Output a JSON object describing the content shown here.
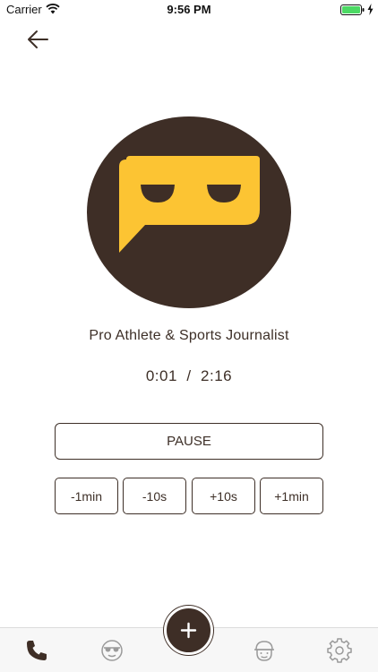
{
  "status_bar": {
    "carrier": "Carrier",
    "time": "9:56 PM",
    "battery_color": "#4cd964"
  },
  "call": {
    "caller_title": "Pro Athlete & Sports Journalist",
    "elapsed": "0:01",
    "total": "2:16",
    "timer_text": "0:01  /  2:16"
  },
  "controls": {
    "pause_label": "PAUSE",
    "seek_buttons": [
      "-1min",
      "-10s",
      "+10s",
      "+1min"
    ]
  },
  "tab_bar": {
    "tabs": [
      "phone-icon",
      "sunglasses-face-icon",
      "add-icon",
      "cap-face-icon",
      "gear-icon"
    ],
    "active_tab": "phone-icon"
  },
  "colors": {
    "brand_dark": "#3e2e26",
    "brand_yellow": "#fcc433",
    "text": "#3d2f27"
  }
}
